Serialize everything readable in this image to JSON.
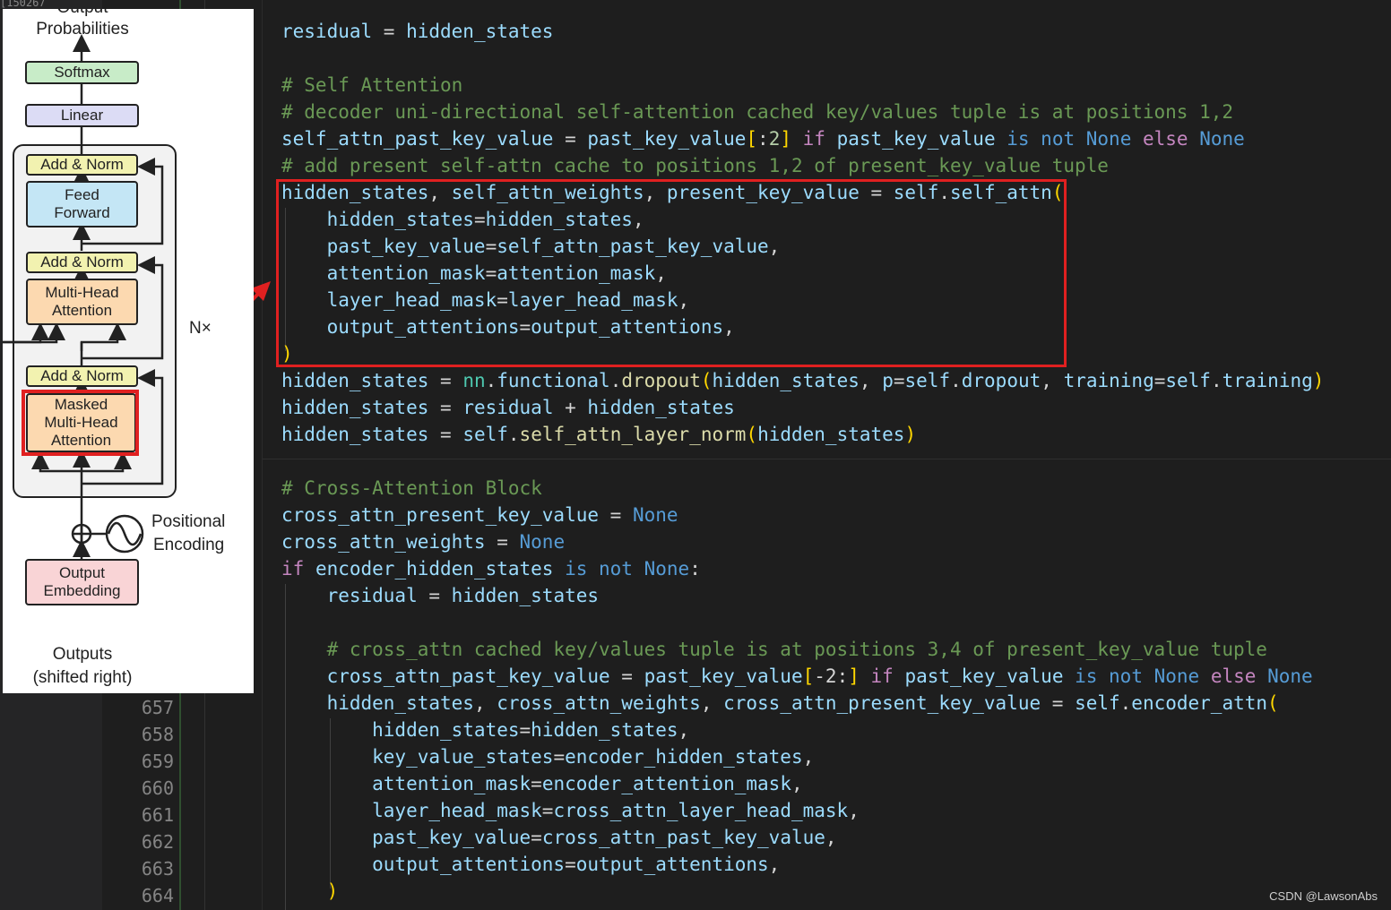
{
  "background_editor": {
    "breadcrumb": "[150267",
    "line_numbers": [
      "657",
      "658",
      "659",
      "660",
      "661",
      "662",
      "663",
      "664"
    ]
  },
  "diagram": {
    "output_probabilities_top": "Output",
    "output_probabilities": "Probabilities",
    "softmax": "Softmax",
    "linear": "Linear",
    "add_norm": "Add & Norm",
    "feed_forward_1": "Feed",
    "feed_forward_2": "Forward",
    "mha_1": "Multi-Head",
    "mha_2": "Attention",
    "masked_1": "Masked",
    "masked_2": "Multi-Head",
    "masked_3": "Attention",
    "nx": "N×",
    "positional_1": "Positional",
    "positional_2": "Encoding",
    "output_emb_1": "Output",
    "output_emb_2": "Embedding",
    "outputs_1": "Outputs",
    "outputs_2": "(shifted right)",
    "accent_color": "#e02020"
  },
  "code": {
    "l1_a": "residual",
    "l1_b": " = ",
    "l1_c": "hidden_states",
    "l2": "",
    "l3": "# Self Attention",
    "l4": "# decoder uni-directional self-attention cached key/values tuple is at positions 1,2",
    "l5_a": "self_attn_past_key_value",
    "l5_b": " = ",
    "l5_c": "past_key_value",
    "l5_d": "[",
    "l5_e": ":",
    "l5_f": "2",
    "l5_g": "]",
    "l5_h": " if ",
    "l5_i": "past_key_value",
    "l5_j": " is not ",
    "l5_k": "None",
    "l5_l": " else ",
    "l5_m": "None",
    "l6": "# add present self-attn cache to positions 1,2 of present_key_value tuple",
    "l7_a": "hidden_states",
    "l7_b": ", ",
    "l7_c": "self_attn_weights",
    "l7_d": ", ",
    "l7_e": "present_key_value",
    "l7_f": " = ",
    "l7_g": "self",
    "l7_h": ".",
    "l7_i": "self_attn",
    "l7_j": "(",
    "l8_a": "    hidden_states",
    "l8_b": "=",
    "l8_c": "hidden_states",
    "l8_d": ",",
    "l9_a": "    past_key_value",
    "l9_b": "=",
    "l9_c": "self_attn_past_key_value",
    "l9_d": ",",
    "l10_a": "    attention_mask",
    "l10_b": "=",
    "l10_c": "attention_mask",
    "l10_d": ",",
    "l11_a": "    layer_head_mask",
    "l11_b": "=",
    "l11_c": "layer_head_mask",
    "l11_d": ",",
    "l12_a": "    output_attentions",
    "l12_b": "=",
    "l12_c": "output_attentions",
    "l12_d": ",",
    "l13": ")",
    "l14_a": "hidden_states",
    "l14_b": " = ",
    "l14_c": "nn",
    "l14_d": ".",
    "l14_e": "functional",
    "l14_f": ".",
    "l14_g": "dropout",
    "l14_h": "(",
    "l14_i": "hidden_states",
    "l14_j": ", ",
    "l14_k": "p",
    "l14_l": "=",
    "l14_m": "self",
    "l14_n": ".",
    "l14_o": "dropout",
    "l14_p": ", ",
    "l14_q": "training",
    "l14_r": "=",
    "l14_s": "self",
    "l14_t": ".",
    "l14_u": "training",
    "l14_v": ")",
    "l15_a": "hidden_states",
    "l15_b": " = ",
    "l15_c": "residual",
    "l15_d": " + ",
    "l15_e": "hidden_states",
    "l16_a": "hidden_states",
    "l16_b": " = ",
    "l16_c": "self",
    "l16_d": ".",
    "l16_e": "self_attn_layer_norm",
    "l16_f": "(",
    "l16_g": "hidden_states",
    "l16_h": ")",
    "l17": "",
    "l18": "# Cross-Attention Block",
    "l19_a": "cross_attn_present_key_value",
    "l19_b": " = ",
    "l19_c": "None",
    "l20_a": "cross_attn_weights",
    "l20_b": " = ",
    "l20_c": "None",
    "l21_a": "if ",
    "l21_b": "encoder_hidden_states",
    "l21_c": " is not ",
    "l21_d": "None",
    "l21_e": ":",
    "l22_a": "    residual",
    "l22_b": " = ",
    "l22_c": "hidden_states",
    "l23": "",
    "l24": "    # cross_attn cached key/values tuple is at positions 3,4 of present_key_value tuple",
    "l25_a": "    cross_attn_past_key_value",
    "l25_b": " = ",
    "l25_c": "past_key_value",
    "l25_d": "[",
    "l25_e": "-2",
    "l25_f": ":",
    "l25_g": "]",
    "l25_h": " if ",
    "l25_i": "past_key_value",
    "l25_j": " is not ",
    "l25_k": "None",
    "l25_l": " else ",
    "l25_m": "None",
    "l26_a": "    hidden_states",
    "l26_b": ", ",
    "l26_c": "cross_attn_weights",
    "l26_d": ", ",
    "l26_e": "cross_attn_present_key_value",
    "l26_f": " = ",
    "l26_g": "self",
    "l26_h": ".",
    "l26_i": "encoder_attn",
    "l26_j": "(",
    "l27_a": "        hidden_states",
    "l27_b": "=",
    "l27_c": "hidden_states",
    "l27_d": ",",
    "l28_a": "        key_value_states",
    "l28_b": "=",
    "l28_c": "encoder_hidden_states",
    "l28_d": ",",
    "l29_a": "        attention_mask",
    "l29_b": "=",
    "l29_c": "encoder_attention_mask",
    "l29_d": ",",
    "l30_a": "        layer_head_mask",
    "l30_b": "=",
    "l30_c": "cross_attn_layer_head_mask",
    "l30_d": ",",
    "l31_a": "        past_key_value",
    "l31_b": "=",
    "l31_c": "cross_attn_past_key_value",
    "l31_d": ",",
    "l32_a": "        output_attentions",
    "l32_b": "=",
    "l32_c": "output_attentions",
    "l32_d": ",",
    "l33": "    )"
  },
  "watermark": "CSDN @LawsonAbs"
}
